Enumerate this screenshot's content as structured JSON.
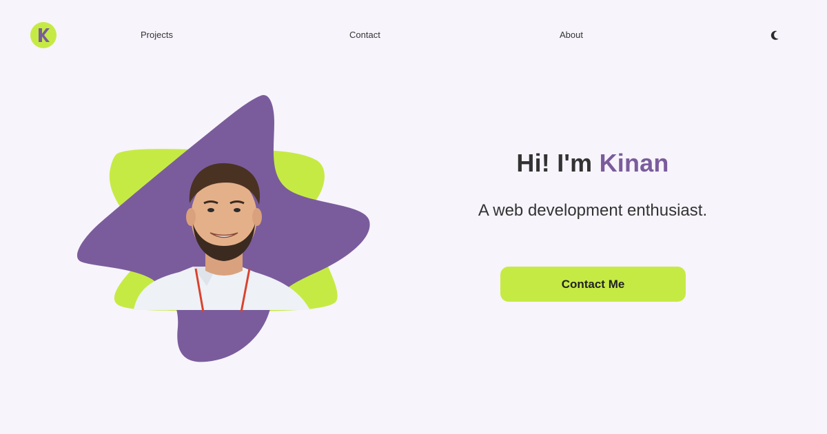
{
  "nav": {
    "logo_letter": "K",
    "links": [
      {
        "label": "Projects"
      },
      {
        "label": "Contact"
      },
      {
        "label": "About"
      }
    ],
    "theme_toggle_icon": "moon-icon"
  },
  "hero": {
    "greeting": "Hi! I'm ",
    "name": "Kinan",
    "subtitle": "A web development enthusiast.",
    "cta_label": "Contact Me",
    "portrait_icon": "portrait-photo"
  },
  "colors": {
    "background": "#f7f4fb",
    "accent_lime": "#c6ea44",
    "accent_purple": "#7a5c9c",
    "text": "#333333"
  }
}
